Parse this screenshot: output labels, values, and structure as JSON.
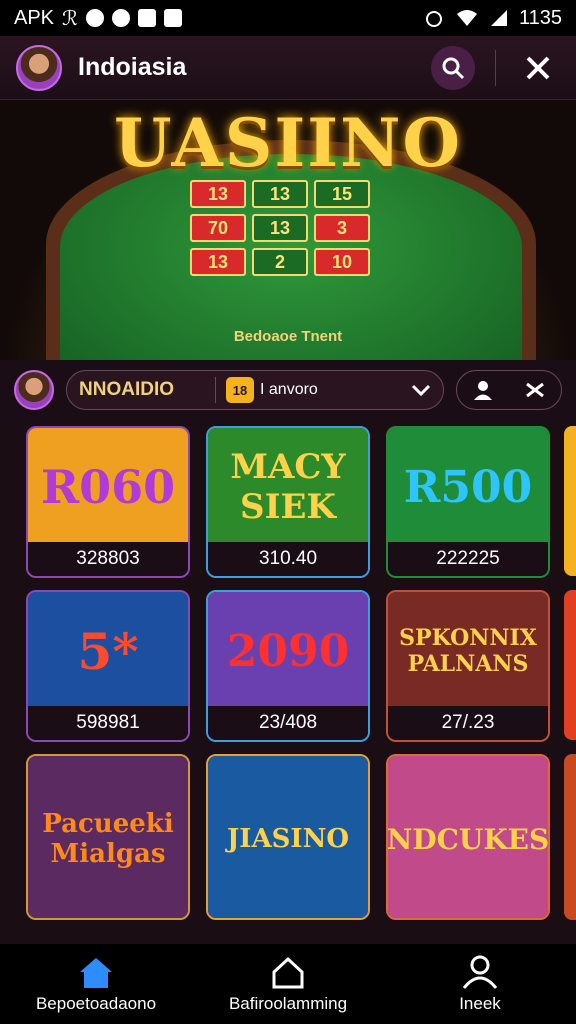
{
  "status_bar": {
    "carrier": "APK",
    "carrier_extra": "ℛ",
    "time": "1135"
  },
  "header": {
    "title": "Indoiasia",
    "search_icon": "search-icon",
    "close_icon": "close-icon"
  },
  "hero": {
    "title": "UASIINO",
    "subtitle": "Bedoaoe Tnent",
    "cells": [
      "13",
      "13",
      "15",
      "70",
      "13",
      "3",
      "13",
      "2",
      "10"
    ]
  },
  "filter_bar": {
    "label": "NNOAIDIO",
    "badge": "18",
    "value": "I anvoro",
    "user_icon": "user-icon",
    "shuffle_icon": "shuffle-icon"
  },
  "games": [
    {
      "title": "R060",
      "caption": "328803",
      "bg": "#f0a020",
      "fg": "#b13ad8"
    },
    {
      "title": "MACY SIEK",
      "caption": "310.40",
      "bg": "#2c8a2a",
      "fg": "#ffd24a"
    },
    {
      "title": "R500",
      "caption": "222225",
      "bg": "#1f8c3a",
      "fg": "#2ec4ff"
    },
    {
      "title": "5*",
      "caption": "598981",
      "bg": "#1c4fa0",
      "fg": "#ff4b2b"
    },
    {
      "title": "2090",
      "caption": "23/408",
      "bg": "#6a3fb0",
      "fg": "#ff3030"
    },
    {
      "title": "SPKONNIX PALNANS",
      "caption": "27/.23",
      "bg": "#7a2a24",
      "fg": "#ffd24a"
    },
    {
      "title": "Pacueeki Mialgas",
      "caption": "",
      "bg": "#5a2a60",
      "fg": "#ff8a1a"
    },
    {
      "title": "JIASINO",
      "caption": "",
      "bg": "#1a5aa0",
      "fg": "#ffd24a"
    },
    {
      "title": "NDCUKES",
      "caption": "",
      "bg": "#c04a8a",
      "fg": "#ffd24a"
    }
  ],
  "bottom_nav": {
    "items": [
      {
        "label": "Bepoetoadaono",
        "icon": "home-icon",
        "active": true
      },
      {
        "label": "Bafiroolamming",
        "icon": "house-outline-icon",
        "active": false
      },
      {
        "label": "Ineek",
        "icon": "profile-icon",
        "active": false
      }
    ]
  }
}
